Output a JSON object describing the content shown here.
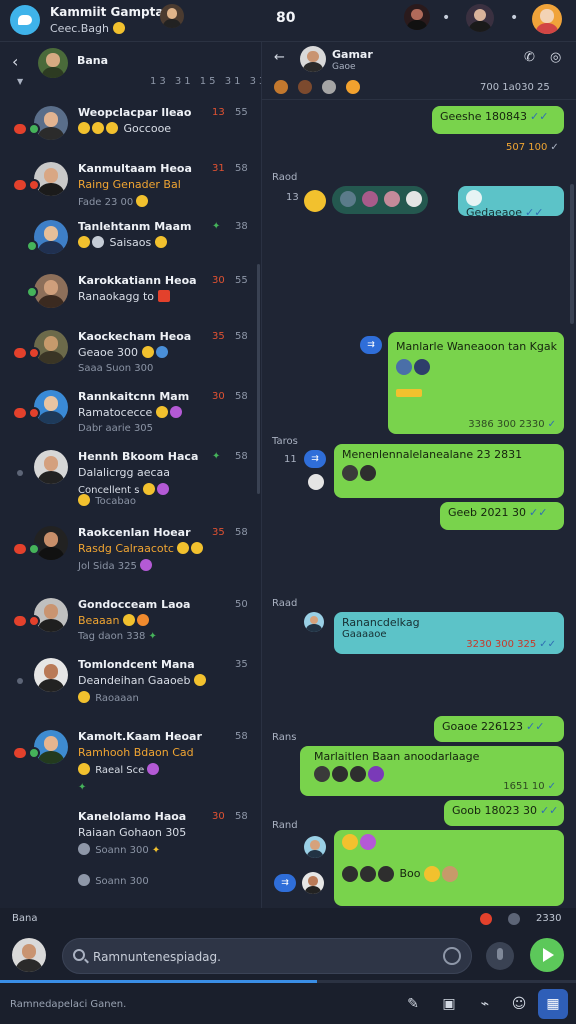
{
  "app": {
    "title": "Kammiit Gamptan",
    "subtitle": "Ceec.Bagh",
    "counter": "80",
    "top_dots": "•",
    "top_dots_right": "•"
  },
  "left_panel": {
    "back_icon": "chevron-left-icon",
    "title": "Bana",
    "filter_icons": "13 31 15 31 33",
    "chats": [
      {
        "name": "Weopclacpar lleao",
        "preview": "Goccooe",
        "meta": "",
        "n1": "13",
        "n2": "55",
        "badge": true
      },
      {
        "name": "Kanmultaam Heoa",
        "preview": "Raing Genader Bal",
        "meta": "Fade 23 00",
        "n1": "31",
        "n2": "58",
        "badge": true
      },
      {
        "name": "Tanlehtanm Maam",
        "preview": "Saisaos",
        "meta": "",
        "n1": "",
        "n2": "38",
        "badge": false
      },
      {
        "name": "Karokkatiann Heoa",
        "preview": "Ranaokagg to",
        "meta": "",
        "n1": "30",
        "n2": "55",
        "badge": false
      },
      {
        "name": "Kaockecham Heoa",
        "preview": "Geaoe 300",
        "meta": "Saaa Suon 300",
        "n1": "35",
        "n2": "58",
        "badge": true
      },
      {
        "name": "Rannkaitcnn Mam",
        "preview": "Ramatocecce",
        "meta": "Dabr aarie 305",
        "n1": "30",
        "n2": "58",
        "badge": true
      },
      {
        "name": "Hennh Bkoom Haca",
        "preview": "Dalalicrgg aecaa",
        "meta": "Concellent s",
        "n1": "",
        "n2": "58",
        "badge": false
      },
      {
        "name": "Raokcenlan Hoear",
        "preview": "Rasdg Calraacotc",
        "meta": "Jol Sida 325",
        "n1": "35",
        "n2": "58",
        "badge": true
      },
      {
        "name": "Gondocceam Laoa",
        "preview": "Beaaan",
        "meta": "Tag daon 338",
        "n1": "",
        "n2": "50",
        "badge": true
      },
      {
        "name": "Tomlondcent Mana",
        "preview": "Deandeihan Gaaoeb",
        "meta": "Raoaaan",
        "n1": "",
        "n2": "35",
        "badge": false
      },
      {
        "name": "Kamolt.Kaam Heoar",
        "preview": "Ramhooh Bdaon Cad",
        "meta": "Raeal Sce",
        "n1": "",
        "n2": "58",
        "badge": true
      },
      {
        "name": "Kanelolamo Haoa",
        "preview": "Raiaan Gohaon 305",
        "meta": "Soann 300",
        "n1": "30",
        "n2": "58",
        "badge": false
      }
    ],
    "extra_meta": "Tocabao"
  },
  "chat": {
    "name": "Gamar",
    "subtitle": "Gaoe",
    "counters": "700 1a030 25",
    "messages": [
      {
        "text": "Geeshe 180843",
        "time": "",
        "side": "out",
        "style": "green"
      },
      {
        "text": "",
        "time": "507 100",
        "side": "out-meta",
        "style": "meta"
      },
      {
        "label": "Raod",
        "text": "Gedaeaoe",
        "side": "out",
        "style": "teal"
      },
      {
        "text": "Manlarle Waneaoon tan Kgak",
        "time": "3386 300 2330",
        "side": "out",
        "style": "green"
      },
      {
        "label": "Taros",
        "text": "Menenlennalelanealane 23 2831",
        "time": "",
        "side": "in",
        "style": "green"
      },
      {
        "text": "Geeb 2021 30",
        "time": "",
        "side": "out",
        "style": "green"
      },
      {
        "label": "Raad",
        "text": "Ranancdelkag",
        "sub": "Gaaaaoe",
        "time": "3230 300 325",
        "side": "in",
        "style": "teal"
      },
      {
        "text": "Goaoe 226123",
        "time": "",
        "side": "out",
        "style": "green"
      },
      {
        "label": "Rans",
        "text": "Marlaitlen Baan anoodarlaage",
        "time": "1651 10",
        "side": "in",
        "style": "green"
      },
      {
        "text": "Goob 18023 30",
        "time": "",
        "side": "out",
        "style": "green"
      },
      {
        "label": "Rand",
        "text": "Boo",
        "time": "",
        "side": "in",
        "style": "green"
      }
    ]
  },
  "status_row": {
    "left": "Bana",
    "right": "2330"
  },
  "compose": {
    "placeholder": "Ramnuntenespiadag.",
    "progress": 0.55
  },
  "bottom_bar": {
    "label": "Ramnedapelaci Ganen.",
    "icons": [
      "compose-icon",
      "image-icon",
      "attach-icon",
      "emoji-icon",
      "grid-icon"
    ]
  },
  "colors": {
    "accent_green": "#79d34c",
    "accent_teal": "#5cc3c8",
    "badge_red": "#e3412c",
    "send_green": "#5cc85a",
    "active_blue": "#2f5fb8"
  }
}
